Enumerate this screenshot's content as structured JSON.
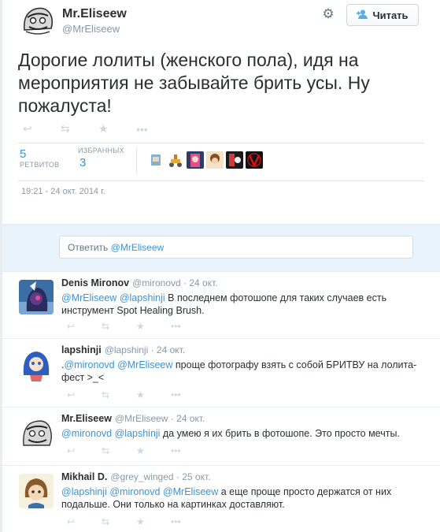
{
  "main_tweet": {
    "author_name": "Mr.Eliseew",
    "author_handle": "@MrEliseew",
    "follow_label": "Читать",
    "text": "Дорогие лолиты (женского пола), идя на мероприятия не забывайте брить усы. Ну пожалуста!",
    "retweets_count": "5",
    "retweets_label": "РЕТВИТОВ",
    "favorites_count": "3",
    "favorites_label": "ИЗБРАННЫХ",
    "timestamp": "19:21 - 24 окт. 2014 г."
  },
  "icons": {
    "reply": "reply-icon",
    "retweet": "retweet-icon",
    "favorite": "star-icon",
    "more": "more-icon",
    "settings": "gear-icon",
    "follow": "add-user-icon"
  },
  "reply_box": {
    "prefix": "Ответить ",
    "mention": "@MrEliseew"
  },
  "replies": [
    {
      "name": "Denis Mironov",
      "handle": "@mironovd",
      "time": "24 окт.",
      "mentions": [
        "@MrEliseew",
        "@lapshinji"
      ],
      "text": " В последнем фотошопе для таких случаев есть инструмент Spot Healing Brush."
    },
    {
      "name": "lapshinji",
      "handle": "@lapshinji",
      "time": "24 окт.",
      "prefix": ".",
      "mentions": [
        "@mironovd",
        "@MrEliseew"
      ],
      "text": " проще фотографу взять с собой БРИТВУ на лолита-фест >_<"
    },
    {
      "name": "Mr.Eliseew",
      "handle": "@MrEliseew",
      "time": "24 окт.",
      "mentions": [
        "@mironovd",
        "@lapshinji"
      ],
      "text": " да умею я их брить в фотошопе. Это просто мечты."
    },
    {
      "name": "Mikhail D.",
      "handle": "@grey_winged",
      "time": "25 окт.",
      "mentions": [
        "@lapshinji",
        "@mironovd",
        "@MrEliseew"
      ],
      "text": " а еще проще просто держатся от них подальше. Они только на картинках доставляют."
    }
  ],
  "colors": {
    "link": "#3b94d9",
    "muted": "#8899a6",
    "background": "#e8edf0"
  }
}
